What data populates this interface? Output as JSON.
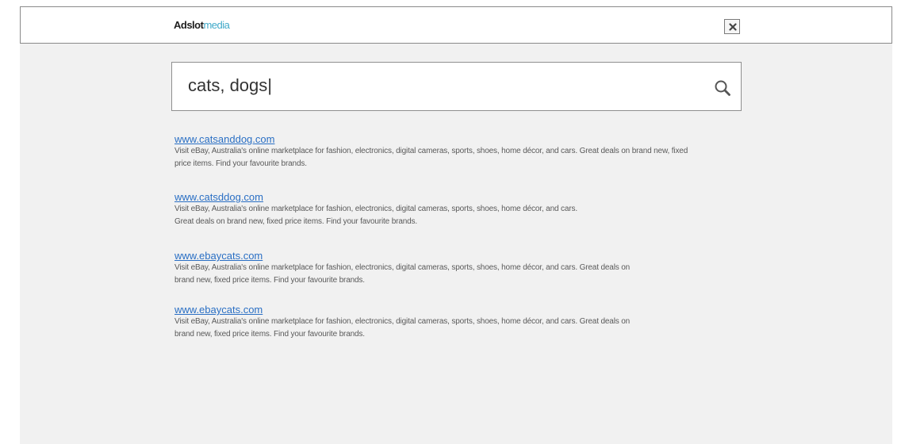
{
  "header": {
    "logo_brand": "Adslot",
    "logo_accent": "media",
    "close_label": "Close"
  },
  "search": {
    "value": "cats, dogs",
    "caret": "|"
  },
  "colors": {
    "accent": "#3fa9c9",
    "link": "#2a6fc4",
    "background": "#f1f1f1"
  },
  "icons": {
    "search": "search-icon",
    "close": "close-icon"
  },
  "results": [
    {
      "url": "www.catsanddog.com",
      "desc_lines": [
        "Visit eBay, Australia's online marketplace for fashion, electronics, digital cameras, sports, shoes, home décor, and cars. Great deals on brand new, fixed",
        "price items. Find your favourite brands."
      ]
    },
    {
      "url": "www.catsddog.com",
      "desc_lines": [
        "Visit eBay, Australia's online marketplace for fashion, electronics, digital cameras, sports, shoes, home décor, and cars.",
        "Great deals on brand new, fixed price items. Find your favourite brands."
      ]
    },
    {
      "url": "www.ebaycats.com",
      "desc_lines": [
        "Visit eBay, Australia's online marketplace for fashion, electronics, digital cameras, sports, shoes, home décor, and cars. Great deals on",
        "brand new, fixed price items. Find your favourite brands."
      ]
    },
    {
      "url": "www.ebaycats.com",
      "desc_lines": [
        "Visit eBay, Australia's online marketplace for fashion, electronics, digital cameras, sports, shoes, home décor, and cars. Great deals on",
        "brand new, fixed price items. Find your favourite brands."
      ]
    }
  ]
}
